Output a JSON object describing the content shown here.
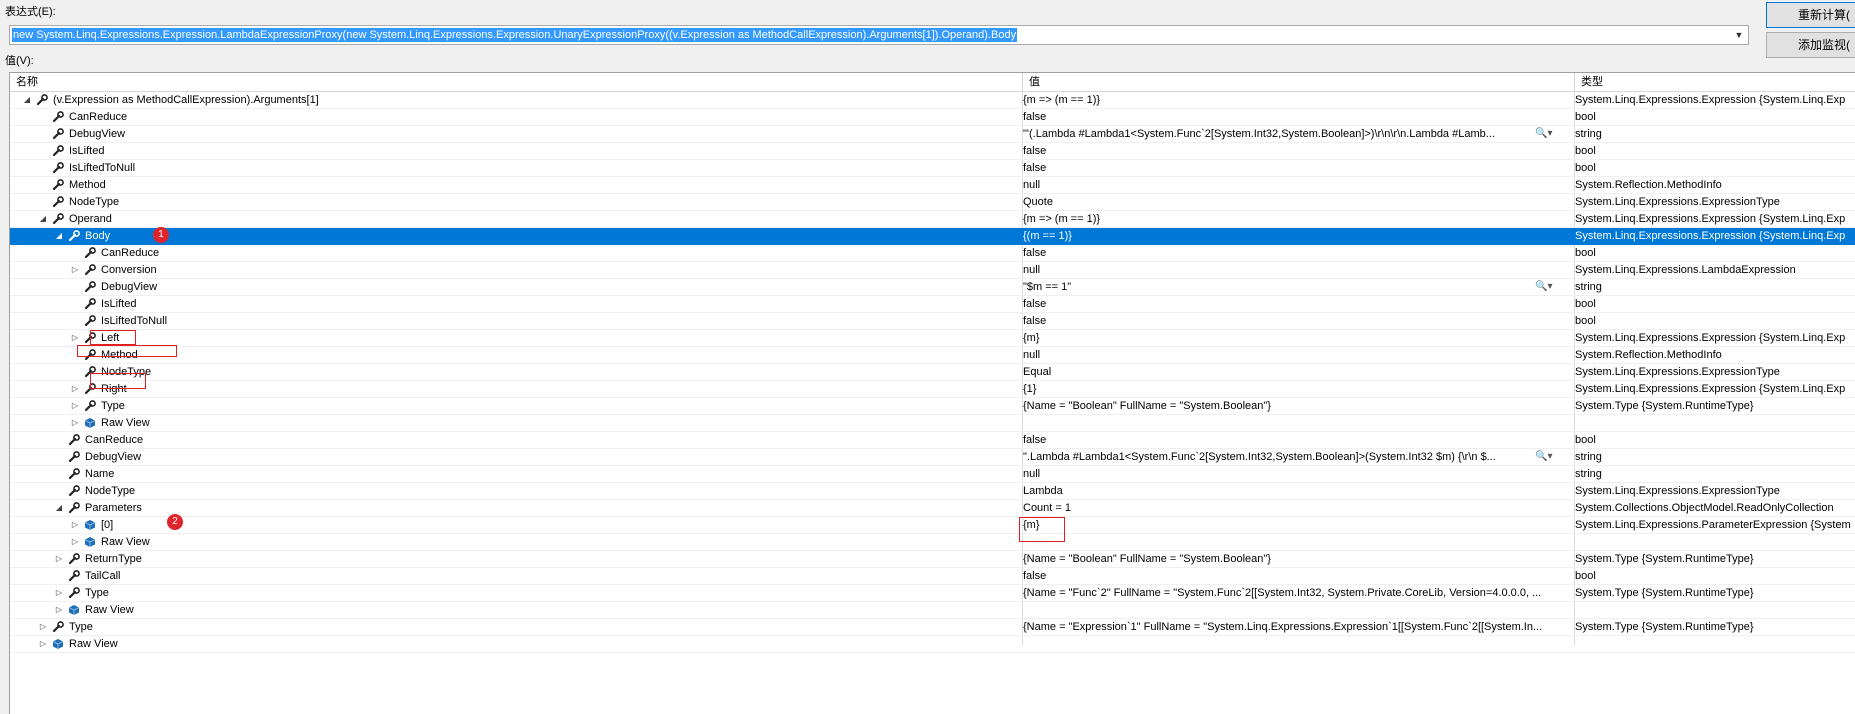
{
  "expression": {
    "label": "表达式(E):",
    "value": "new System.Linq.Expressions.Expression.LambdaExpressionProxy(new System.Linq.Expressions.Expression.UnaryExpressionProxy((v.Expression as MethodCallExpression).Arguments[1]).Operand).Body"
  },
  "buttons": {
    "recalculate": "重新计算(",
    "add_watch": "添加监视("
  },
  "value_label": "值(V):",
  "columns": {
    "name": "名称",
    "value": "值",
    "type": "类型"
  },
  "rows": [
    {
      "name": "(v.Expression as MethodCallExpression).Arguments[1]",
      "value": "{m => (m == 1)}",
      "type": "System.Linq.Expressions.Expression {System.Linq.Exp",
      "level": 0,
      "expander": "expanded",
      "icon": "wrench"
    },
    {
      "name": "CanReduce",
      "value": "false",
      "type": "bool",
      "level": 1,
      "expander": "none",
      "icon": "wrench"
    },
    {
      "name": "DebugView",
      "value": "\"'(.Lambda #Lambda1<System.Func`2[System.Int32,System.Boolean]>)\\r\\n\\r\\n.Lambda #Lamb...",
      "type": "string",
      "level": 1,
      "expander": "none",
      "icon": "wrench",
      "magnifier": true
    },
    {
      "name": "IsLifted",
      "value": "false",
      "type": "bool",
      "level": 1,
      "expander": "none",
      "icon": "wrench"
    },
    {
      "name": "IsLiftedToNull",
      "value": "false",
      "type": "bool",
      "level": 1,
      "expander": "none",
      "icon": "wrench"
    },
    {
      "name": "Method",
      "value": "null",
      "type": "System.Reflection.MethodInfo",
      "level": 1,
      "expander": "none",
      "icon": "wrench"
    },
    {
      "name": "NodeType",
      "value": "Quote",
      "type": "System.Linq.Expressions.ExpressionType",
      "level": 1,
      "expander": "none",
      "icon": "wrench"
    },
    {
      "name": "Operand",
      "value": "{m => (m == 1)}",
      "type": "System.Linq.Expressions.Expression {System.Linq.Exp",
      "level": 1,
      "expander": "expanded",
      "icon": "wrench"
    },
    {
      "name": "Body",
      "value": "{(m == 1)}",
      "type": "System.Linq.Expressions.Expression {System.Linq.Exp",
      "level": 2,
      "expander": "expanded",
      "icon": "wrench",
      "selected": true
    },
    {
      "name": "CanReduce",
      "value": "false",
      "type": "bool",
      "level": 3,
      "expander": "none",
      "icon": "wrench"
    },
    {
      "name": "Conversion",
      "value": "null",
      "type": "System.Linq.Expressions.LambdaExpression",
      "level": 3,
      "expander": "collapsed",
      "icon": "wrench"
    },
    {
      "name": "DebugView",
      "value": "\"$m == 1\"",
      "type": "string",
      "level": 3,
      "expander": "none",
      "icon": "wrench",
      "magnifier": true
    },
    {
      "name": "IsLifted",
      "value": "false",
      "type": "bool",
      "level": 3,
      "expander": "none",
      "icon": "wrench"
    },
    {
      "name": "IsLiftedToNull",
      "value": "false",
      "type": "bool",
      "level": 3,
      "expander": "none",
      "icon": "wrench"
    },
    {
      "name": "Left",
      "value": "{m}",
      "type": "System.Linq.Expressions.Expression {System.Linq.Exp",
      "level": 3,
      "expander": "collapsed",
      "icon": "wrench"
    },
    {
      "name": "Method",
      "value": "null",
      "type": "System.Reflection.MethodInfo",
      "level": 3,
      "expander": "none",
      "icon": "wrench"
    },
    {
      "name": "NodeType",
      "value": "Equal",
      "type": "System.Linq.Expressions.ExpressionType",
      "level": 3,
      "expander": "none",
      "icon": "wrench"
    },
    {
      "name": "Right",
      "value": "{1}",
      "type": "System.Linq.Expressions.Expression {System.Linq.Exp",
      "level": 3,
      "expander": "collapsed",
      "icon": "wrench"
    },
    {
      "name": "Type",
      "value": "{Name = \"Boolean\" FullName = \"System.Boolean\"}",
      "type": "System.Type {System.RuntimeType}",
      "level": 3,
      "expander": "collapsed",
      "icon": "wrench"
    },
    {
      "name": "Raw View",
      "value": "",
      "type": "",
      "level": 3,
      "expander": "collapsed",
      "icon": "cube"
    },
    {
      "name": "CanReduce",
      "value": "false",
      "type": "bool",
      "level": 2,
      "expander": "none",
      "icon": "wrench"
    },
    {
      "name": "DebugView",
      "value": "\".Lambda #Lambda1<System.Func`2[System.Int32,System.Boolean]>(System.Int32 $m) {\\r\\n    $...",
      "type": "string",
      "level": 2,
      "expander": "none",
      "icon": "wrench",
      "magnifier": true
    },
    {
      "name": "Name",
      "value": "null",
      "type": "string",
      "level": 2,
      "expander": "none",
      "icon": "wrench"
    },
    {
      "name": "NodeType",
      "value": "Lambda",
      "type": "System.Linq.Expressions.ExpressionType",
      "level": 2,
      "expander": "none",
      "icon": "wrench"
    },
    {
      "name": "Parameters",
      "value": "Count = 1",
      "type": "System.Collections.ObjectModel.ReadOnlyCollection",
      "level": 2,
      "expander": "expanded",
      "icon": "wrench"
    },
    {
      "name": "[0]",
      "value": "{m}",
      "type": "System.Linq.Expressions.ParameterExpression {System",
      "level": 3,
      "expander": "collapsed",
      "icon": "cube"
    },
    {
      "name": "Raw View",
      "value": "",
      "type": "",
      "level": 3,
      "expander": "collapsed",
      "icon": "cube"
    },
    {
      "name": "ReturnType",
      "value": "{Name = \"Boolean\" FullName = \"System.Boolean\"}",
      "type": "System.Type {System.RuntimeType}",
      "level": 2,
      "expander": "collapsed",
      "icon": "wrench"
    },
    {
      "name": "TailCall",
      "value": "false",
      "type": "bool",
      "level": 2,
      "expander": "none",
      "icon": "wrench"
    },
    {
      "name": "Type",
      "value": "{Name = \"Func`2\" FullName = \"System.Func`2[[System.Int32, System.Private.CoreLib, Version=4.0.0.0, ...",
      "type": "System.Type {System.RuntimeType}",
      "level": 2,
      "expander": "collapsed",
      "icon": "wrench"
    },
    {
      "name": "Raw View",
      "value": "",
      "type": "",
      "level": 2,
      "expander": "collapsed",
      "icon": "cube"
    },
    {
      "name": "Type",
      "value": "{Name = \"Expression`1\" FullName = \"System.Linq.Expressions.Expression`1[[System.Func`2[[System.In...",
      "type": "System.Type {System.RuntimeType}",
      "level": 1,
      "expander": "collapsed",
      "icon": "wrench"
    },
    {
      "name": "Raw View",
      "value": "",
      "type": "",
      "level": 1,
      "expander": "collapsed",
      "icon": "cube"
    }
  ],
  "annotations": {
    "badge1": "1",
    "badge2": "2"
  },
  "colors": {
    "selection": "#0078d7",
    "annotation_red": "#e02020",
    "badge_red": "#e0242b"
  }
}
